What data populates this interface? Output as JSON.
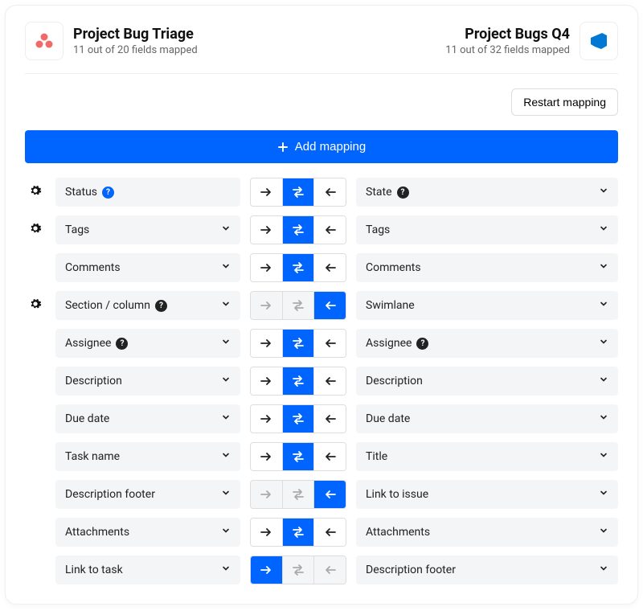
{
  "left_project": {
    "title": "Project Bug Triage",
    "status": "11 out of 20 fields mapped"
  },
  "right_project": {
    "title": "Project Bugs Q4",
    "status": "11 out of 32 fields mapped"
  },
  "restart_label": "Restart mapping",
  "add_label": "Add mapping",
  "rows": [
    {
      "gear": true,
      "left": "Status",
      "left_help": "blue",
      "left_chevron": false,
      "dir": "both",
      "right": "State",
      "right_help": "black"
    },
    {
      "gear": true,
      "left": "Tags",
      "left_help": null,
      "left_chevron": true,
      "dir": "both",
      "right": "Tags",
      "right_help": null
    },
    {
      "gear": false,
      "left": "Comments",
      "left_help": null,
      "left_chevron": true,
      "dir": "both",
      "right": "Comments",
      "right_help": null
    },
    {
      "gear": true,
      "left": "Section / column",
      "left_help": "black",
      "left_chevron": true,
      "dir": "left",
      "right": "Swimlane",
      "right_help": null
    },
    {
      "gear": false,
      "left": "Assignee",
      "left_help": "black",
      "left_chevron": true,
      "dir": "both",
      "right": "Assignee",
      "right_help": "black"
    },
    {
      "gear": false,
      "left": "Description",
      "left_help": null,
      "left_chevron": true,
      "dir": "both",
      "right": "Description",
      "right_help": null
    },
    {
      "gear": false,
      "left": "Due date",
      "left_help": null,
      "left_chevron": true,
      "dir": "both",
      "right": "Due date",
      "right_help": null
    },
    {
      "gear": false,
      "left": "Task name",
      "left_help": null,
      "left_chevron": true,
      "dir": "both",
      "right": "Title",
      "right_help": null
    },
    {
      "gear": false,
      "left": "Description footer",
      "left_help": null,
      "left_chevron": true,
      "dir": "left",
      "right": "Link to issue",
      "right_help": null
    },
    {
      "gear": false,
      "left": "Attachments",
      "left_help": null,
      "left_chevron": true,
      "dir": "both",
      "right": "Attachments",
      "right_help": null
    },
    {
      "gear": false,
      "left": "Link to task",
      "left_help": null,
      "left_chevron": true,
      "dir": "right",
      "right": "Description footer",
      "right_help": null
    }
  ]
}
